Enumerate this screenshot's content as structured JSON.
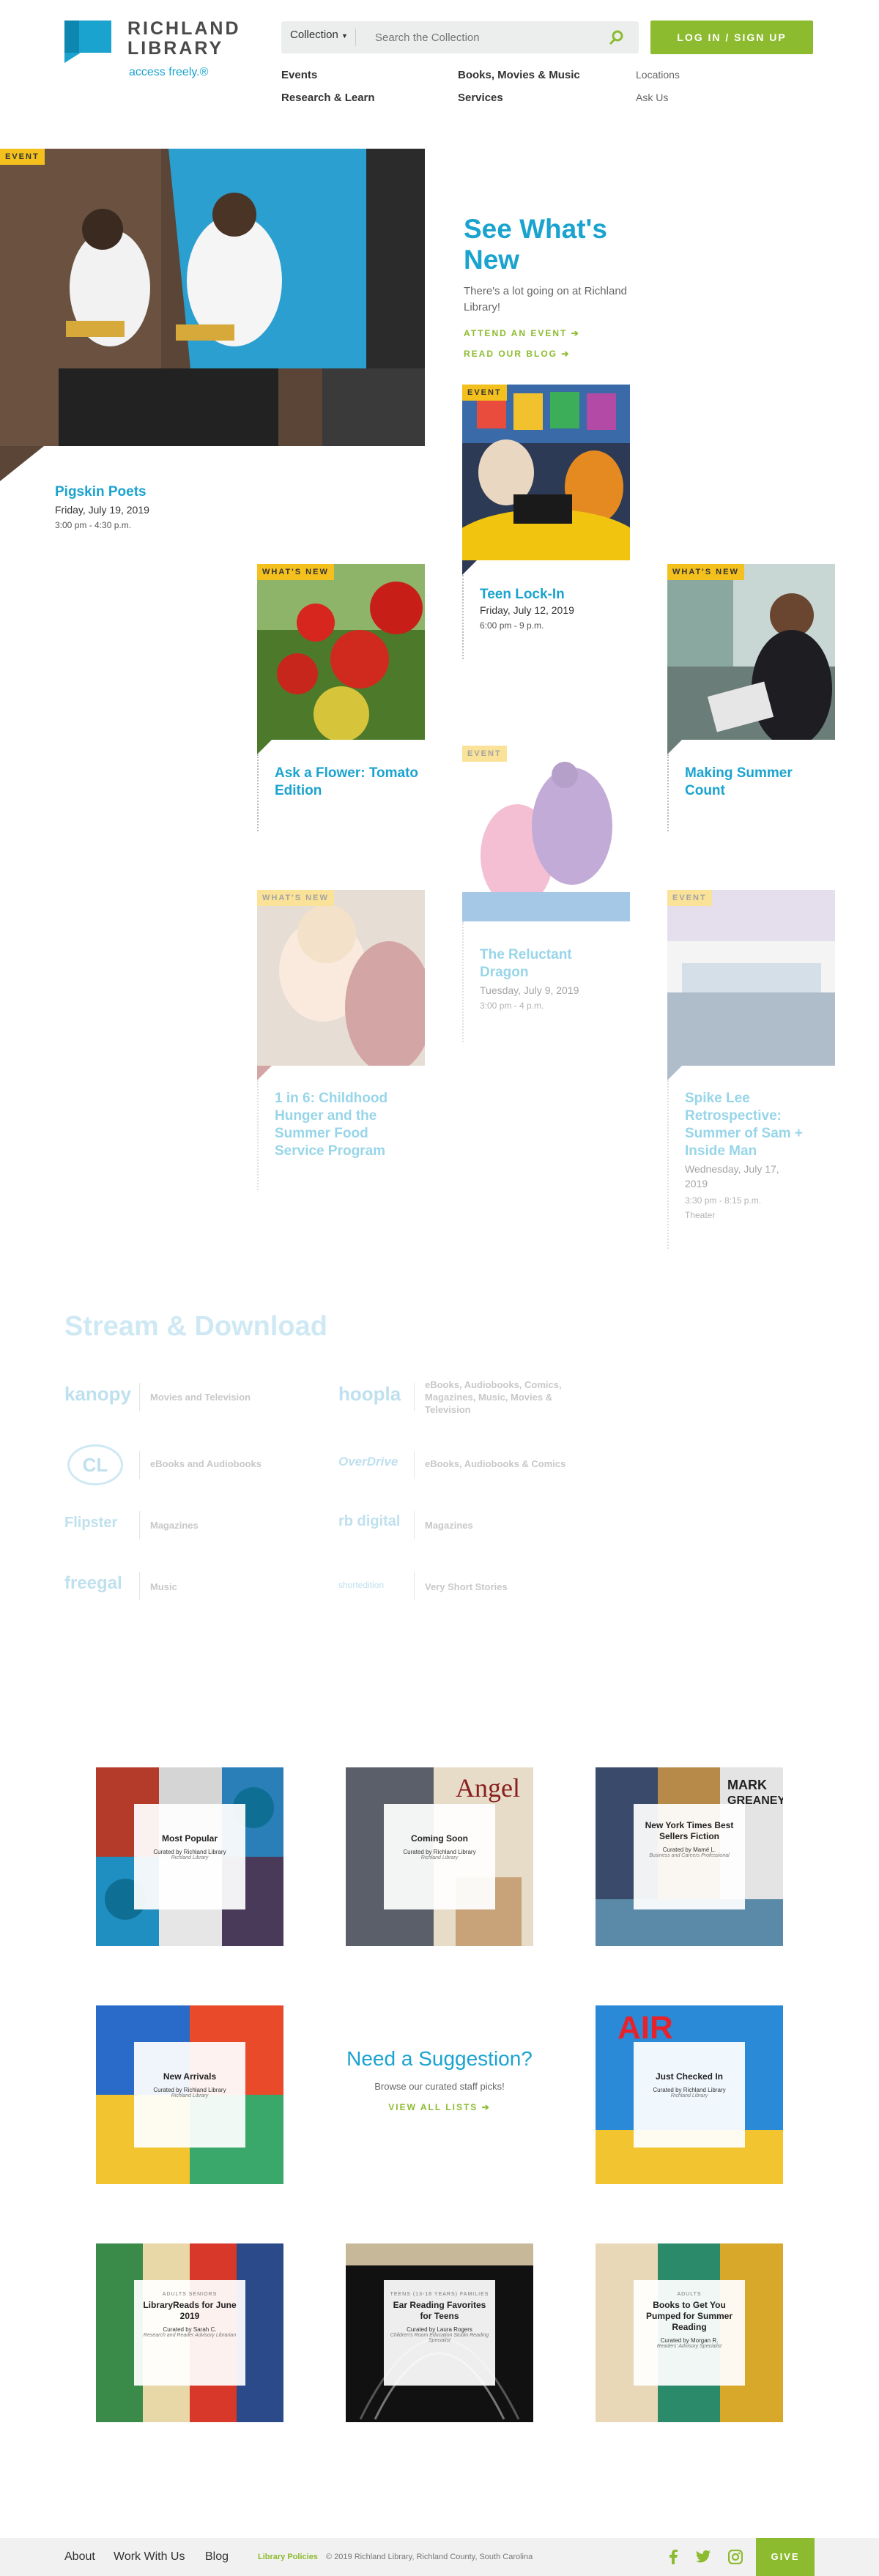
{
  "header": {
    "logo_line1": "RICHLAND",
    "logo_line2": "LIBRARY",
    "tagline": "access freely.®",
    "collection_label": "Collection",
    "search_placeholder": "Search the Collection",
    "login_label": "LOG IN / SIGN UP",
    "nav": [
      "Events",
      "Books, Movies & Music",
      "Research & Learn",
      "Services"
    ],
    "subnav": [
      "Locations",
      "Ask Us"
    ]
  },
  "hero": {
    "badge": "EVENT",
    "title": "Pigskin Poets",
    "date": "Friday, July 19, 2019",
    "time": "3:00 pm - 4:30 p.m."
  },
  "intro": {
    "title": "See What's New",
    "text": "There's a lot going on at Richland Library!",
    "link1": "ATTEND AN EVENT ➔",
    "link2": "READ OUR BLOG ➔"
  },
  "cards": [
    {
      "badge": "EVENT",
      "title": "Teen Lock-In",
      "date": "Friday, July 12, 2019",
      "time": "6:00 pm - 9 p.m."
    },
    {
      "badge": "WHAT'S NEW",
      "title": "Ask a Flower: Tomato Edition"
    },
    {
      "badge": "WHAT'S NEW",
      "title": "Making Summer Count"
    },
    {
      "badge": "EVENT",
      "title": "The Reluctant Dragon",
      "date": "Tuesday, July 9, 2019",
      "time": "3:00 pm - 4 p.m."
    },
    {
      "badge": "WHAT'S NEW",
      "title": "1 in 6: Childhood Hunger and the Summer Food Service Program"
    },
    {
      "badge": "EVENT",
      "title": "Spike Lee Retrospective: Summer of Sam + Inside Man",
      "date": "Wednesday, July 17, 2019",
      "time": "3:30 pm - 8:15 p.m.",
      "place": "Theater"
    }
  ],
  "stream": {
    "title": "Stream & Download",
    "services": [
      {
        "logo": "kanopy",
        "desc": "Movies and Television"
      },
      {
        "logo": "hoopla",
        "desc": "eBooks, Audiobooks, Comics, Magazines, Music, Movies & Television"
      },
      {
        "logo": "CL",
        "desc": "eBooks and Audiobooks"
      },
      {
        "logo": "OverDrive",
        "desc": "eBooks, Audiobooks & Comics"
      },
      {
        "logo": "Flipster",
        "desc": "Magazines"
      },
      {
        "logo": "rb digital",
        "desc": "Magazines"
      },
      {
        "logo": "freegal",
        "desc": "Music"
      },
      {
        "logo": "shortedition",
        "desc": "Very Short Stories"
      }
    ]
  },
  "lists": [
    {
      "title": "Most Popular",
      "curator": "Curated by Richland Library",
      "role": "Richland Library"
    },
    {
      "title": "Coming Soon",
      "curator": "Curated by Richland Library",
      "role": "Richland Library"
    },
    {
      "title": "New York Times Best Sellers Fiction",
      "curator": "Curated by Mamé L.",
      "role": "Business and Careers Professional"
    },
    {
      "title": "New Arrivals",
      "curator": "Curated by Richland Library",
      "role": "Richland Library"
    },
    {
      "title": "Just Checked In",
      "curator": "Curated by Richland Library",
      "role": "Richland Library"
    },
    {
      "series": "ADULTS SENIORS",
      "title": "LibraryReads for June 2019",
      "curator": "Curated by Sarah C.",
      "role": "Research and Reader Advisory Librarian"
    },
    {
      "series": "TEENS (13-18 YEARS) FAMILIES",
      "title": "Ear Reading Favorites for Teens",
      "curator": "Curated by Laura Rogers",
      "role": "Children's Room Education Studio Reading Specialist"
    },
    {
      "series": "ADULTS",
      "title": "Books to Get You Pumped for Summer Reading",
      "curator": "Curated by Morgan R.",
      "role": "Readers' Advisory Specialist"
    }
  ],
  "suggestion": {
    "title": "Need a Suggestion?",
    "text": "Browse our curated staff picks!",
    "link": "VIEW ALL LISTS ➔"
  },
  "footer": {
    "links": [
      "About",
      "Work With Us",
      "Blog"
    ],
    "policies": "Library Policies",
    "copyright": "© 2019 Richland Library, Richland County, South Carolina",
    "give": "GIVE"
  },
  "colors": {
    "accent": "#1aa3cf",
    "brand_green": "#8dbb2f",
    "badge": "#f4c01d"
  }
}
